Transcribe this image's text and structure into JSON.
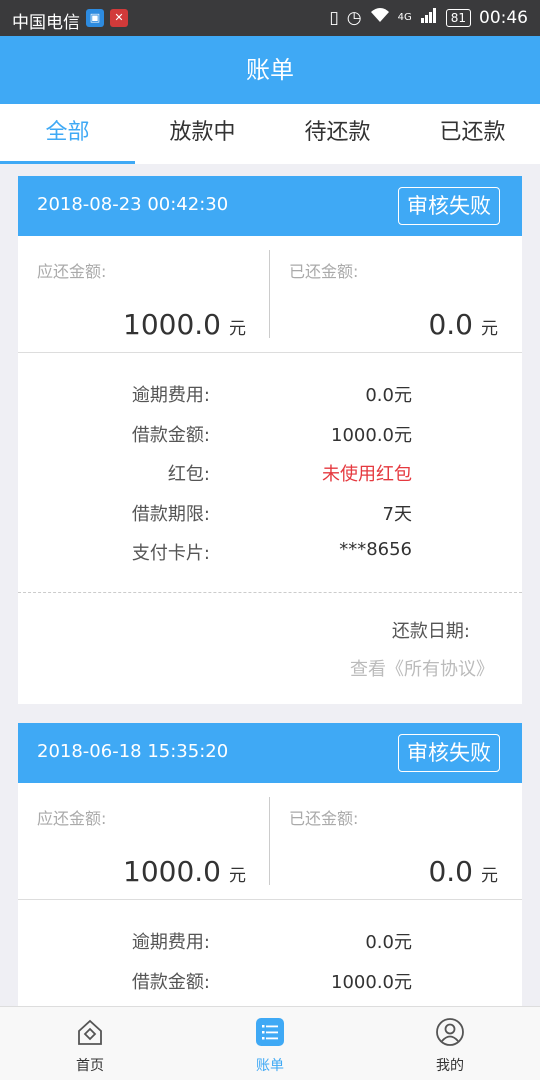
{
  "statusbar": {
    "carrier": "中国电信",
    "network": "4G",
    "battery": "81",
    "time": "00:46"
  },
  "header": {
    "title": "账单"
  },
  "tabs": [
    {
      "label": "全部",
      "active": true
    },
    {
      "label": "放款中",
      "active": false
    },
    {
      "label": "待还款",
      "active": false
    },
    {
      "label": "已还款",
      "active": false
    }
  ],
  "bills": [
    {
      "datetime": "2018-08-23 00:42:30",
      "status": "审核失败",
      "due_label": "应还金额:",
      "due_amount": "1000.0",
      "paid_label": "已还金额:",
      "paid_amount": "0.0",
      "unit": "元",
      "details": [
        {
          "key": "逾期费用:",
          "value": "0.0元"
        },
        {
          "key": "借款金额:",
          "value": "1000.0元"
        },
        {
          "key": "红包:",
          "value": "未使用红包"
        },
        {
          "key": "借款期限:",
          "value": "7天"
        },
        {
          "key": "支付卡片:",
          "value": "***8656"
        }
      ],
      "repay_date_label": "还款日期:",
      "agreement_link": "查看《所有协议》"
    },
    {
      "datetime": "2018-06-18 15:35:20",
      "status": "审核失败",
      "due_label": "应还金额:",
      "due_amount": "1000.0",
      "paid_label": "已还金额:",
      "paid_amount": "0.0",
      "unit": "元",
      "details": [
        {
          "key": "逾期费用:",
          "value": "0.0元"
        },
        {
          "key": "借款金额:",
          "value": "1000.0元"
        }
      ]
    }
  ],
  "bottom_nav": [
    {
      "label": "首页",
      "icon": "home-icon",
      "active": false
    },
    {
      "label": "账单",
      "icon": "bill-list-icon",
      "active": true
    },
    {
      "label": "我的",
      "icon": "profile-icon",
      "active": false
    }
  ],
  "colors": {
    "accent": "#3fa9f5",
    "red": "#e5393f"
  }
}
